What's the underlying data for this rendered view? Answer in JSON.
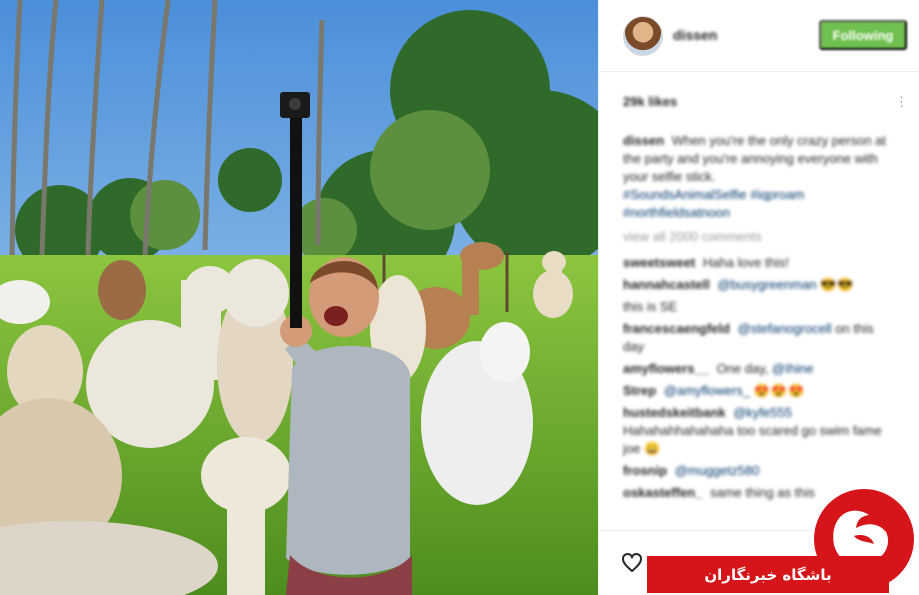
{
  "post": {
    "username": "dissen",
    "follow_label": "Following",
    "likes": "29k likes",
    "view_all_comments": "view all 2000 comments",
    "more_symbol": "⋮"
  },
  "caption": {
    "user": "dissen",
    "text": "When you're the only crazy person at the party and you're annoying everyone with your selfie stick.",
    "tags": "#SoundsAnimalSelfie #iqproam #northfieldsatnoon"
  },
  "comments": [
    {
      "user": "sweetsweet",
      "text": "Haha love this!",
      "tag": "",
      "emoji": ""
    },
    {
      "user": "hannahcastell",
      "text": "",
      "tag": "@busygreenman",
      "emoji": "😎😎"
    },
    {
      "user": "",
      "text": "this is SE",
      "tag": "",
      "emoji": ""
    },
    {
      "user": "francescaengfeld",
      "text": "on this day",
      "tag": "@stefanogrocell",
      "emoji": ""
    },
    {
      "user": "amyflowers__",
      "text": "One day,",
      "tag": "@Ihine",
      "emoji": ""
    },
    {
      "user": "Strep",
      "text": "",
      "tag": "@amyflowers_",
      "emoji": "😍😍😍"
    },
    {
      "user": "hustedskeitbank",
      "text": "Hahahahhahahaha too scared go swim fame joe",
      "tag": "@kyfe555",
      "emoji": "😀"
    },
    {
      "user": "frosnip",
      "text": "",
      "tag": "@muggetz580",
      "emoji": ""
    },
    {
      "user": "oskasteffen_",
      "text": "same thing as this",
      "tag": "",
      "emoji": ""
    }
  ],
  "watermark": {
    "text": "باشگاه خبرنگاران",
    "logo_glyph": "ج"
  },
  "colors": {
    "follow_green": "#70c050",
    "link_blue": "#003569",
    "watermark_red": "#d6151a"
  },
  "icons": {
    "like": "heart-icon",
    "more": "more-options-icon"
  }
}
